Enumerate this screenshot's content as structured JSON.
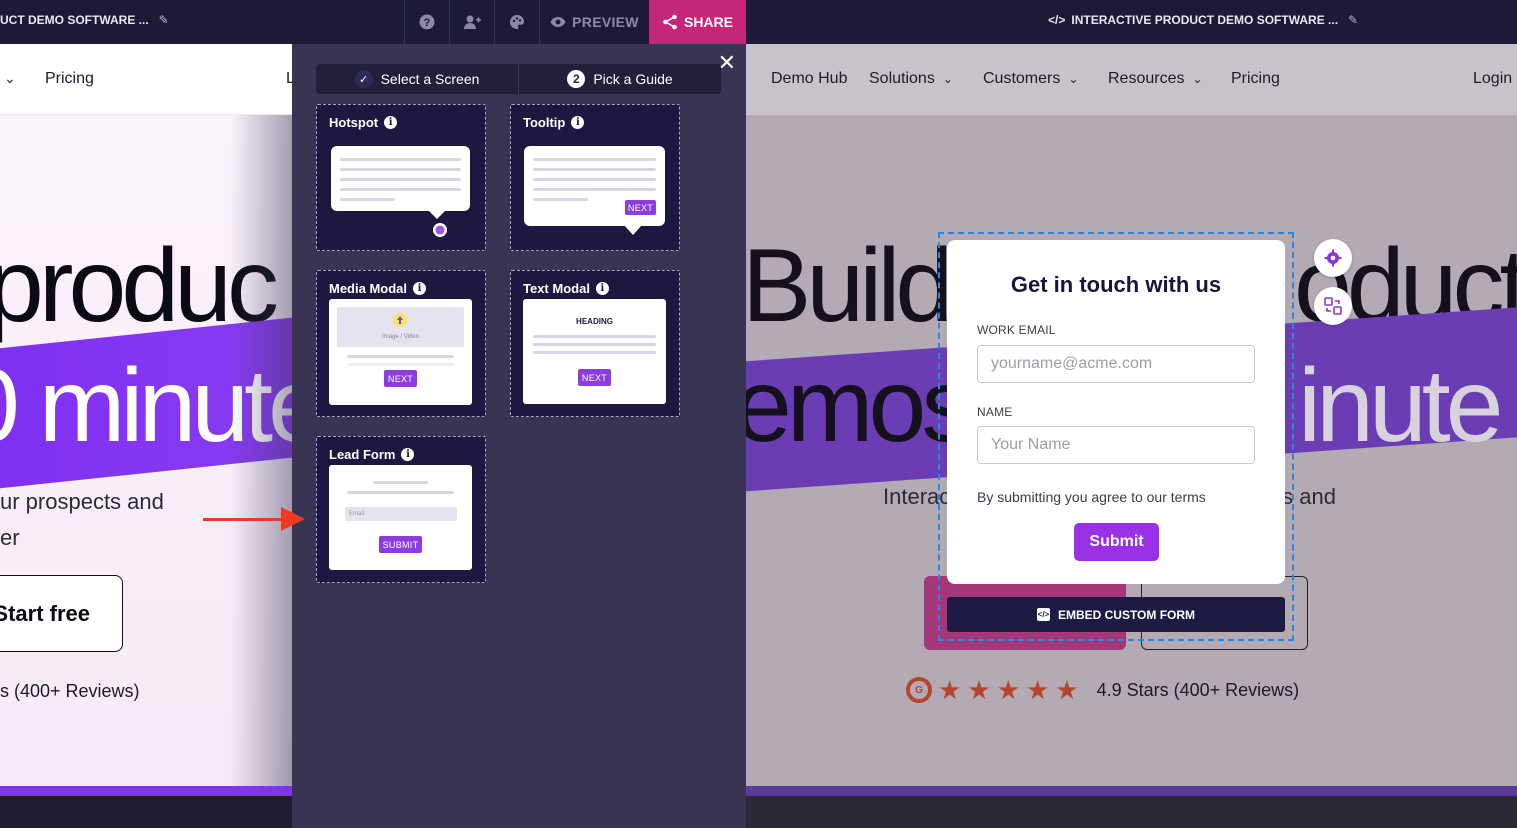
{
  "topbar": {
    "title_left": "UCT DEMO SOFTWARE ...",
    "preview_label": "PREVIEW",
    "share_label": "SHARE",
    "title_right": "INTERACTIVE PRODUCT DEMO SOFTWARE ...",
    "share_color": "#c6267a"
  },
  "site_left": {
    "nav_pricing": "Pricing",
    "nav_L": "L",
    "hero_line1": "produc",
    "hero_line2": "0 minute",
    "sub_line1": "ur prospects and",
    "sub_line2": "er",
    "start_button": "Start free",
    "reviews": "s (400+ Reviews)"
  },
  "panel": {
    "tab_select": "Select a Screen",
    "tab_pick_number": "2",
    "tab_pick": "Pick a Guide",
    "cards": {
      "hotspot": "Hotspot",
      "tooltip": "Tooltip",
      "tooltip_next": "NEXT",
      "media_modal": "Media Modal",
      "media_caption": "Image / Video",
      "media_next": "NEXT",
      "text_modal": "Text Modal",
      "text_heading": "HEADING",
      "text_next": "NEXT",
      "lead_form": "Lead Form",
      "lead_email": "Email",
      "lead_submit": "SUBMIT"
    }
  },
  "site_right": {
    "nav": {
      "demo_hub": "Demo Hub",
      "solutions": "Solutions",
      "customers": "Customers",
      "resources": "Resources",
      "pricing": "Pricing",
      "login": "Login"
    },
    "hero_line1_left": "Build",
    "hero_line1_right": "oduct",
    "hero_line2_left": "emos",
    "hero_line2_right": "inute",
    "sub_left": "Interac",
    "sub_right": "ts and",
    "rating": "4.9 Stars (400+ Reviews)"
  },
  "form": {
    "title": "Get in touch with us",
    "email_label": "WORK EMAIL",
    "email_placeholder": "yourname@acme.com",
    "name_label": "NAME",
    "name_placeholder": "Your Name",
    "note": "By submitting you agree to our terms",
    "submit": "Submit",
    "embed_button": "EMBED CUSTOM FORM"
  }
}
